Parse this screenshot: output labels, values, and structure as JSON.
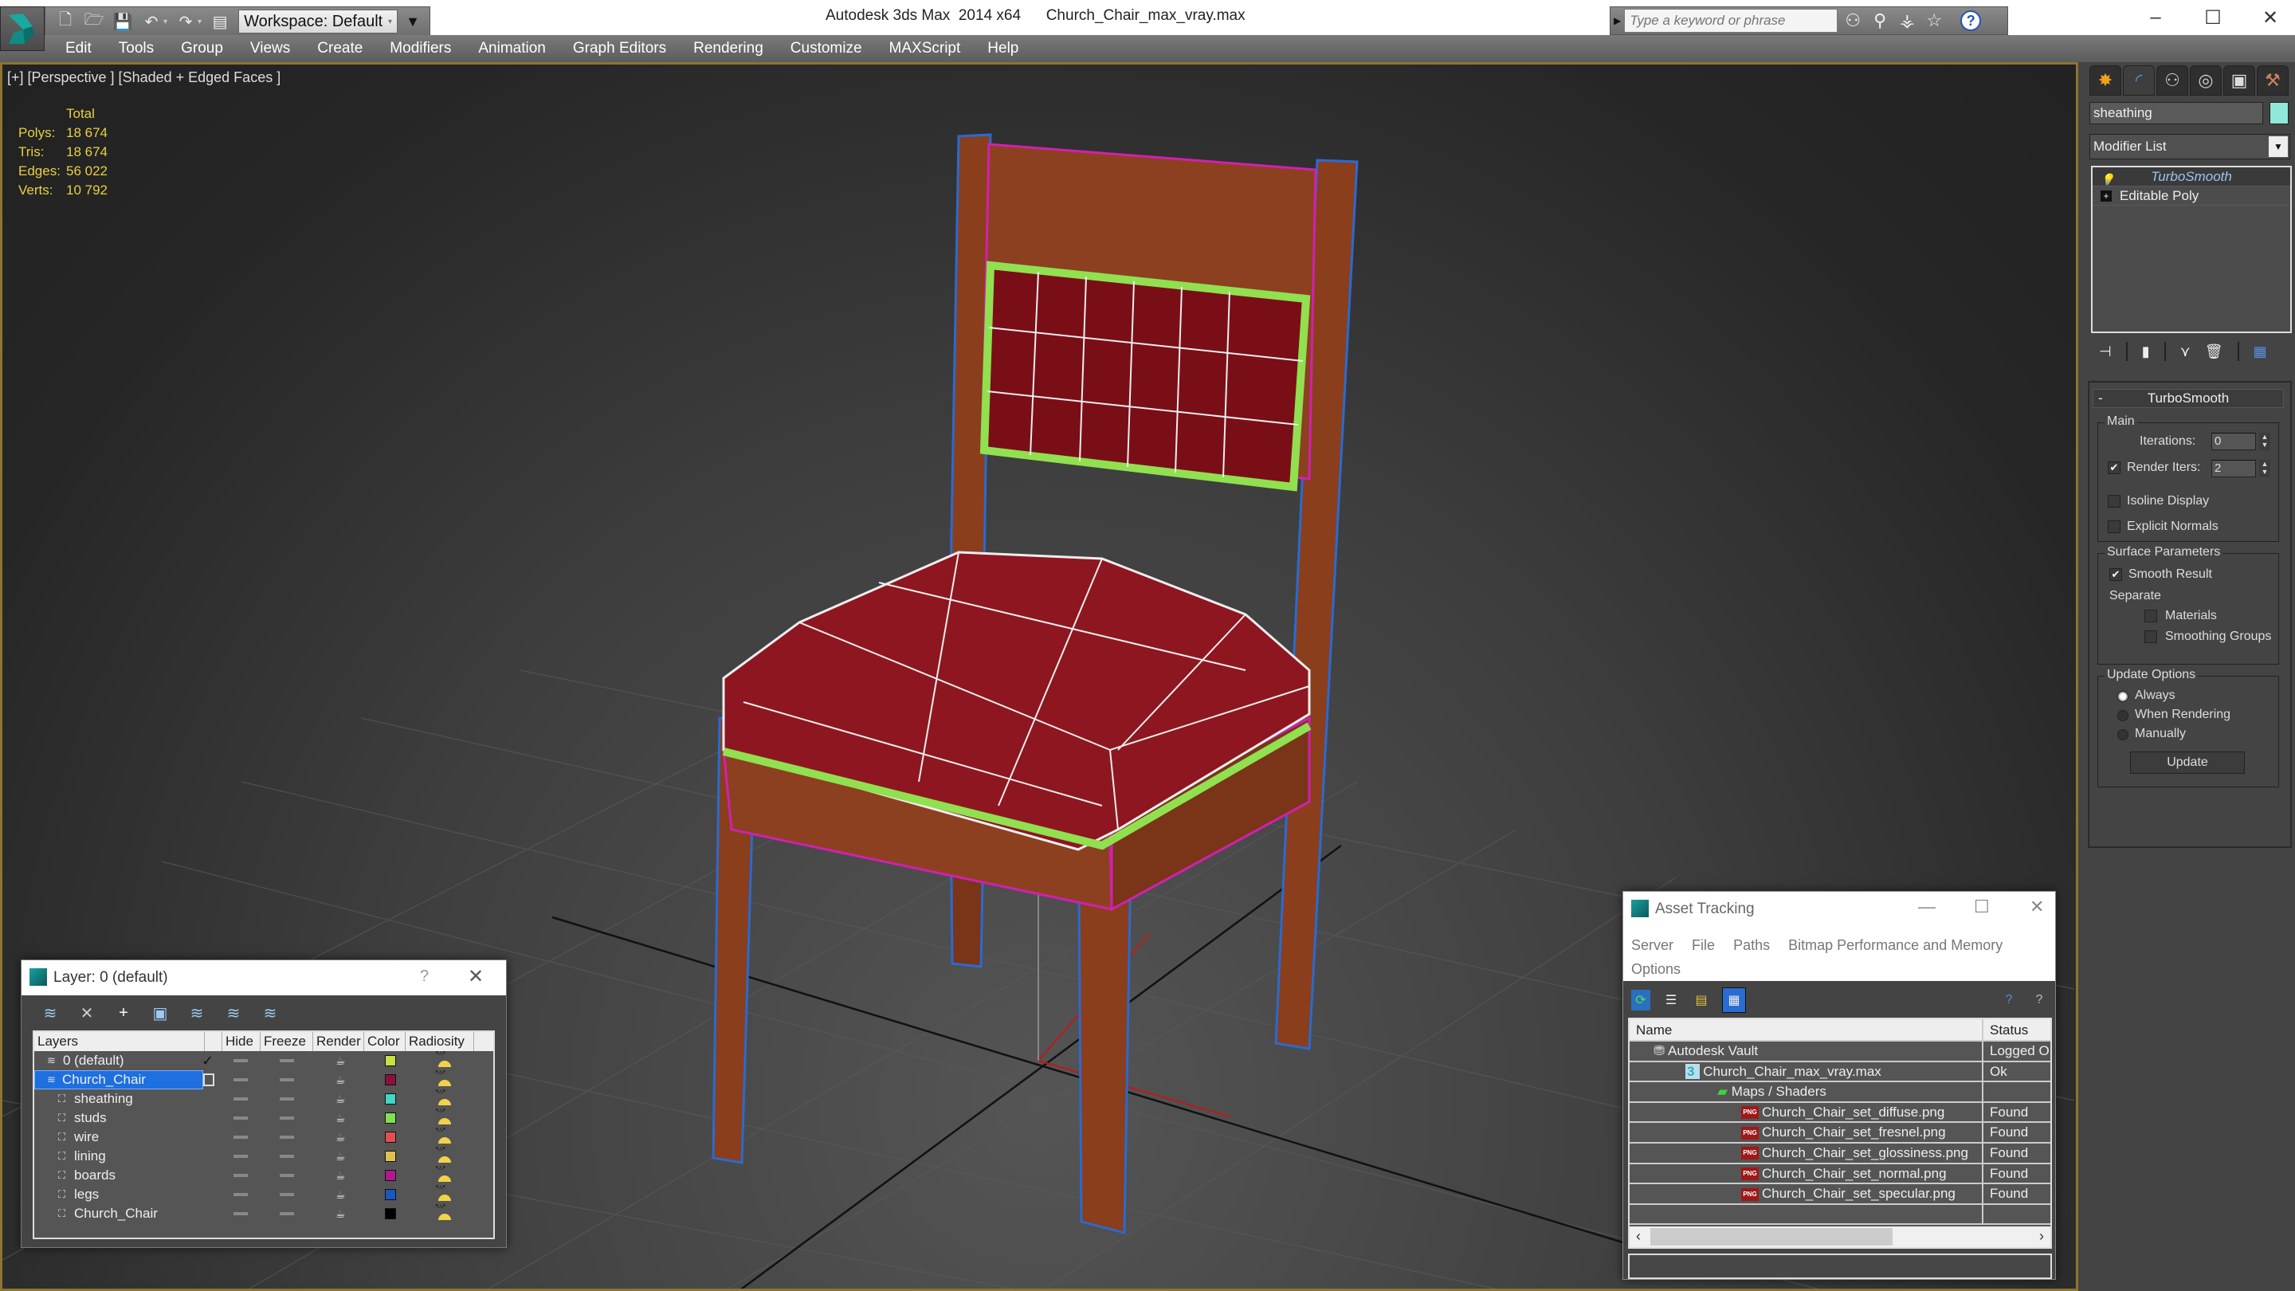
{
  "app": {
    "title": "Autodesk 3ds Max  2014 x64      Church_Chair_max_vray.max",
    "workspace": "Workspace: Default",
    "search_placeholder": "Type a keyword or phrase",
    "window_controls": {
      "minimize": "–",
      "maximize": "☐",
      "close": "✕"
    }
  },
  "quick_access": [
    "new-icon",
    "open-icon",
    "save-icon",
    "undo-icon",
    "redo-icon",
    "project-icon"
  ],
  "menu": [
    "Edit",
    "Tools",
    "Group",
    "Views",
    "Create",
    "Modifiers",
    "Animation",
    "Graph Editors",
    "Rendering",
    "Customize",
    "MAXScript",
    "Help"
  ],
  "viewport": {
    "label": "[+] [Perspective ] [Shaded + Edged Faces ]",
    "stats": {
      "header": "Total",
      "rows": [
        {
          "k": "Polys:",
          "v": "18 674"
        },
        {
          "k": "Tris:",
          "v": "18 674"
        },
        {
          "k": "Edges:",
          "v": "56 022"
        },
        {
          "k": "Verts:",
          "v": "10 792"
        }
      ]
    },
    "colors": {
      "wood": "#8a3e1c",
      "fabric": "#8e1620",
      "legs_wire": "#2a6ad0",
      "boards_wire": "#d020b0",
      "studs": "#90e050"
    }
  },
  "command_panel": {
    "tabs": [
      "create-icon",
      "modify-icon",
      "hierarchy-icon",
      "motion-icon",
      "display-icon",
      "utilities-icon"
    ],
    "object_name": "sheathing",
    "object_color": "#8fe8d8",
    "modifier_list": "Modifier List",
    "stack": [
      {
        "label": "TurboSmooth",
        "selected": true
      },
      {
        "label": "Editable Poly",
        "selected": false
      }
    ],
    "rollout": {
      "title": "TurboSmooth",
      "collapse": "-",
      "main_group": "Main",
      "iterations_label": "Iterations:",
      "iterations_value": "0",
      "render_iters_label": "Render Iters:",
      "render_iters_value": "2",
      "render_iters_checked": true,
      "isoline_label": "Isoline Display",
      "explicit_normals_label": "Explicit Normals",
      "surface_group": "Surface Parameters",
      "smooth_result_label": "Smooth Result",
      "separate_label": "Separate",
      "materials_label": "Materials",
      "smoothing_groups_label": "Smoothing Groups",
      "update_group": "Update Options",
      "always_label": "Always",
      "when_rendering_label": "When Rendering",
      "manually_label": "Manually",
      "update_button": "Update"
    }
  },
  "layer_dialog": {
    "title": "Layer: 0 (default)",
    "help": "?",
    "close": "✕",
    "columns": [
      "Layers",
      "",
      "Hide",
      "Freeze",
      "Render",
      "Color",
      "Radiosity"
    ],
    "rows": [
      {
        "name": "0 (default)",
        "level": 0,
        "current": true,
        "color": "#c8e040"
      },
      {
        "name": "Church_Chair",
        "level": 0,
        "selected": true,
        "color": "#8a1040"
      },
      {
        "name": "sheathing",
        "level": 1,
        "color": "#40d8c0"
      },
      {
        "name": "studs",
        "level": 1,
        "color": "#80e050"
      },
      {
        "name": "wire",
        "level": 1,
        "color": "#e05050"
      },
      {
        "name": "lining",
        "level": 1,
        "color": "#e0c050"
      },
      {
        "name": "boards",
        "level": 1,
        "color": "#b01890"
      },
      {
        "name": "legs",
        "level": 1,
        "color": "#1858c0"
      },
      {
        "name": "Church_Chair",
        "level": 1,
        "color": "#000000"
      }
    ]
  },
  "asset_dialog": {
    "title": "Asset Tracking",
    "menu": [
      "Server",
      "File",
      "Paths",
      "Bitmap Performance and Memory",
      "Options"
    ],
    "columns": [
      "Name",
      "Status"
    ],
    "rows": [
      {
        "name": "Autodesk Vault",
        "status": "Logged O",
        "level": 0,
        "icon": "vault-icon"
      },
      {
        "name": "Church_Chair_max_vray.max",
        "status": "Ok",
        "level": 1,
        "icon": "max-file-icon"
      },
      {
        "name": "Maps / Shaders",
        "status": "",
        "level": 2,
        "icon": "maps-icon"
      },
      {
        "name": "Church_Chair_set_diffuse.png",
        "status": "Found",
        "level": 3,
        "icon": "png-icon"
      },
      {
        "name": "Church_Chair_set_fresnel.png",
        "status": "Found",
        "level": 3,
        "icon": "png-icon"
      },
      {
        "name": "Church_Chair_set_glossiness.png",
        "status": "Found",
        "level": 3,
        "icon": "png-icon"
      },
      {
        "name": "Church_Chair_set_normal.png",
        "status": "Found",
        "level": 3,
        "icon": "png-icon"
      },
      {
        "name": "Church_Chair_set_specular.png",
        "status": "Found",
        "level": 3,
        "icon": "png-icon"
      }
    ]
  }
}
